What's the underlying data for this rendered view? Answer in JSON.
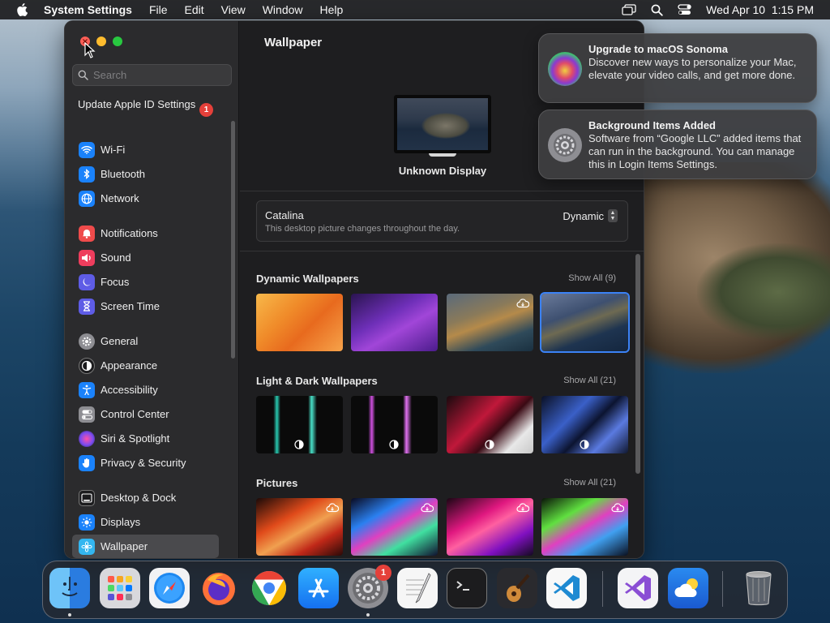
{
  "menubar": {
    "app_name": "System Settings",
    "menus": [
      "File",
      "Edit",
      "View",
      "Window",
      "Help"
    ],
    "datetime": "Wed Apr 10  1:15 PM",
    "status_icons": [
      "screen-mirroring-icon",
      "spotlight-search-icon",
      "control-center-icon"
    ]
  },
  "sidebar": {
    "search_placeholder": "Search",
    "apple_id": {
      "label": "Update Apple ID Settings",
      "badge": "1"
    },
    "items": [
      {
        "label": "Wi-Fi",
        "icon": "wifi-icon",
        "color": "#1a82fb"
      },
      {
        "label": "Bluetooth",
        "icon": "bluetooth-icon",
        "color": "#1a82fb"
      },
      {
        "label": "Network",
        "icon": "globe-icon",
        "color": "#1a82fb"
      },
      {
        "label": "Notifications",
        "icon": "bell-icon",
        "color": "#ef4b4b"
      },
      {
        "label": "Sound",
        "icon": "speaker-icon",
        "color": "#ee3d5d"
      },
      {
        "label": "Focus",
        "icon": "moon-icon",
        "color": "#5e5ce6"
      },
      {
        "label": "Screen Time",
        "icon": "hourglass-icon",
        "color": "#5e5ce6"
      },
      {
        "label": "General",
        "icon": "gear-icon",
        "color": "#8e8e93"
      },
      {
        "label": "Appearance",
        "icon": "appearance-icon",
        "color": "#1c1c1e"
      },
      {
        "label": "Accessibility",
        "icon": "accessibility-icon",
        "color": "#1a82fb"
      },
      {
        "label": "Control Center",
        "icon": "switches-icon",
        "color": "#8e8e93"
      },
      {
        "label": "Siri & Spotlight",
        "icon": "siri-icon",
        "color": "#b04ce0"
      },
      {
        "label": "Privacy & Security",
        "icon": "hand-icon",
        "color": "#1a82fb"
      },
      {
        "label": "Desktop & Dock",
        "icon": "dock-icon",
        "color": "#1c1c1e"
      },
      {
        "label": "Displays",
        "icon": "sun-icon",
        "color": "#1a82fb"
      },
      {
        "label": "Wallpaper",
        "icon": "wallpaper-icon",
        "color": "#33b6f0",
        "selected": true
      }
    ]
  },
  "main": {
    "title": "Wallpaper",
    "display_name": "Unknown Display",
    "current": {
      "name": "Catalina",
      "description": "This desktop picture changes throughout the day.",
      "mode": "Dynamic"
    },
    "sections": [
      {
        "title": "Dynamic Wallpapers",
        "show_all": "Show All (9)"
      },
      {
        "title": "Light & Dark Wallpapers",
        "show_all": "Show All (21)"
      },
      {
        "title": "Pictures",
        "show_all": "Show All (21)"
      }
    ]
  },
  "notifications": [
    {
      "title": "Upgrade to macOS Sonoma",
      "body": "Discover new ways to personalize your Mac, elevate your video calls, and get more done."
    },
    {
      "title": "Background Items Added",
      "body": "Software from “Google LLC” added items that can run in the background. You can manage this in Login Items Settings."
    }
  ],
  "dock": {
    "items": [
      "Finder",
      "Launchpad",
      "Safari",
      "Firefox",
      "Google Chrome",
      "App Store",
      "System Settings",
      "TextEdit",
      "Terminal",
      "GarageBand",
      "Visual Studio Code",
      "Visual Studio",
      "Weather",
      "Trash"
    ],
    "system_settings_badge": "1"
  }
}
